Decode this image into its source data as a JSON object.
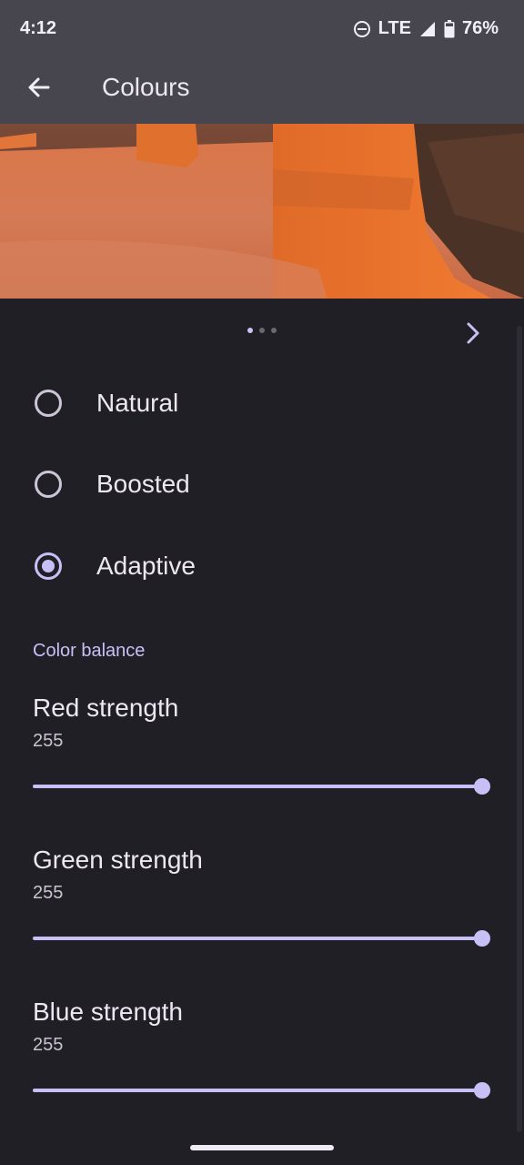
{
  "status_bar": {
    "time": "4:12",
    "network": "LTE",
    "battery": "76%"
  },
  "app_bar": {
    "title": "Colours",
    "back_icon": "arrow-back-icon"
  },
  "preview": {
    "pages": 3,
    "active_page": 1,
    "next_icon": "chevron-right-icon"
  },
  "modes": [
    {
      "label": "Natural",
      "checked": false
    },
    {
      "label": "Boosted",
      "checked": false
    },
    {
      "label": "Adaptive",
      "checked": true
    }
  ],
  "color_balance": {
    "header": "Color balance",
    "sliders": [
      {
        "label": "Red strength",
        "value": "255",
        "fraction": 1.0
      },
      {
        "label": "Green strength",
        "value": "255",
        "fraction": 1.0
      },
      {
        "label": "Blue strength",
        "value": "255",
        "fraction": 1.0
      }
    ]
  },
  "colors": {
    "background": "#211f26",
    "accent": "#c7c0f7",
    "topbar": "#47464f"
  }
}
